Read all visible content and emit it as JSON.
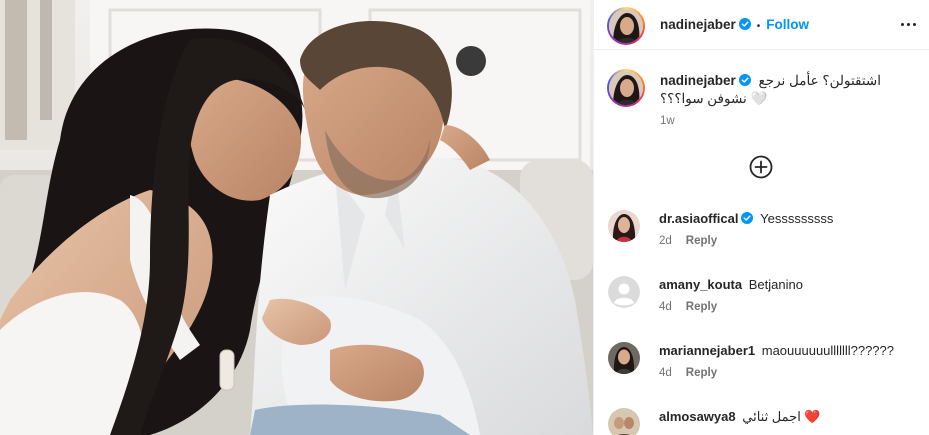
{
  "post": {
    "author": "nadinejaber",
    "follow_label": "Follow",
    "separator": "•",
    "caption_line1": "اشتقتولن؟ عأمل نرجع",
    "caption_line2": "نشوفن سوا؟؟؟ 🤍",
    "caption_time": "1w"
  },
  "comments": [
    {
      "user": "dr.asiaoffical",
      "text": "Yesssssssss",
      "time": "2d",
      "reply": "Reply",
      "verified": true
    },
    {
      "user": "amany_kouta",
      "text": "Betjanino",
      "time": "4d",
      "reply": "Reply",
      "verified": false
    },
    {
      "user": "mariannejaber1",
      "text": "maouuuuuulllllll??????",
      "time": "4d",
      "reply": "Reply",
      "verified": false
    },
    {
      "user": "almosawya8",
      "text": "اجمل ثنائي ❤️",
      "time": "",
      "reply": "",
      "verified": false
    }
  ],
  "icons": {
    "verified": "verified-badge-icon",
    "more": "more-options-icon",
    "load_more": "plus-circle-icon",
    "default_avatar": "default-avatar-icon"
  },
  "colors": {
    "link_blue": "#0095f6",
    "verified_blue": "#0095f6",
    "muted": "#737373",
    "text": "#262626",
    "border": "#efefef"
  }
}
